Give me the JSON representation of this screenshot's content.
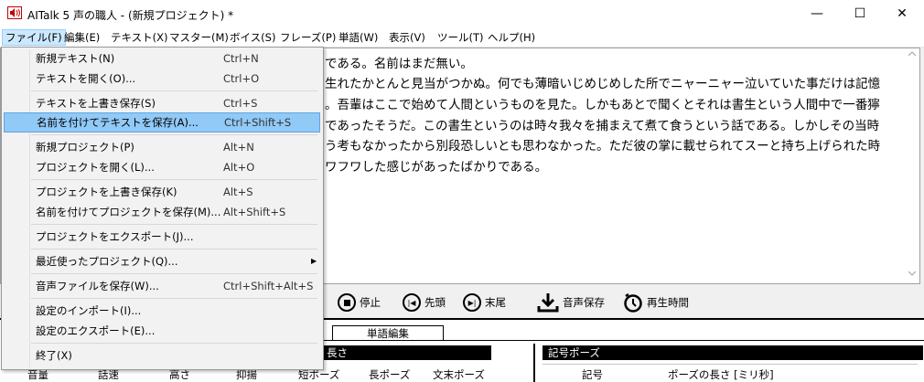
{
  "window": {
    "title": "AITalk 5 声の職人 - (新規プロジェクト) *",
    "controls": {
      "minimize": "—",
      "maximize": "☐",
      "close": "✕"
    }
  },
  "menubar": {
    "items": [
      {
        "label": "ファイル(F)"
      },
      {
        "label": "編集(E)"
      },
      {
        "label": "テキスト(X)"
      },
      {
        "label": "マスター(M)"
      },
      {
        "label": "ボイス(S)"
      },
      {
        "label": "フレーズ(P)"
      },
      {
        "label": "単語(W)"
      },
      {
        "label": "表示(V)"
      },
      {
        "label": "ツール(T)"
      },
      {
        "label": "ヘルプ(H)"
      }
    ]
  },
  "file_menu": {
    "items": [
      {
        "label": "新規テキスト(N)",
        "shortcut": "Ctrl+N"
      },
      {
        "label": "テキストを開く(O)...",
        "shortcut": "Ctrl+O"
      },
      {
        "label": "テキストを上書き保存(S)",
        "shortcut": "Ctrl+S"
      },
      {
        "label": "名前を付けてテキストを保存(A)...",
        "shortcut": "Ctrl+Shift+S"
      },
      {
        "label": "新規プロジェクト(P)",
        "shortcut": "Alt+N"
      },
      {
        "label": "プロジェクトを開く(L)...",
        "shortcut": "Alt+O"
      },
      {
        "label": "プロジェクトを上書き保存(K)",
        "shortcut": "Alt+S"
      },
      {
        "label": "名前を付けてプロジェクトを保存(M)...",
        "shortcut": "Alt+Shift+S"
      },
      {
        "label": "プロジェクトをエクスポート(J)...",
        "shortcut": ""
      },
      {
        "label": "最近使ったプロジェクト(Q)...",
        "shortcut": ""
      },
      {
        "label": "音声ファイルを保存(W)...",
        "shortcut": "Ctrl+Shift+Alt+S"
      },
      {
        "label": "設定のインポート(I)...",
        "shortcut": ""
      },
      {
        "label": "設定のエクスポート(E)...",
        "shortcut": ""
      },
      {
        "label": "終了(X)",
        "shortcut": ""
      }
    ]
  },
  "editor": {
    "lines": [
      "である。名前はまだ無い。",
      "生れたかとんと見当がつかぬ。何でも薄暗いじめじめした所でニャーニャー泣いていた事だけは記憶",
      "。吾輩はここで始めて人間というものを見た。しかもあとで聞くとそれは書生という人間中で一番獰",
      "であったそうだ。この書生というのは時々我々を捕まえて煮て食うという話である。しかしその当時",
      "う考もなかったから別段恐しいとも思わなかった。ただ彼の掌に載せられてスーと持ち上げられた時",
      "ワフワした感じがあったばかりである。"
    ]
  },
  "playback": {
    "stop": "停止",
    "to_start": "先頭",
    "to_end": "末尾",
    "save_audio": "音声保存",
    "play_time": "再生時間"
  },
  "lower": {
    "tab_word_edit": "単語編集",
    "section_length": "長さ",
    "section_symbol_pause": "記号ポーズ",
    "columns": [
      "音量",
      "話速",
      "高さ",
      "抑揚",
      "短ポーズ",
      "長ポーズ",
      "文末ポーズ"
    ],
    "symbol_columns": [
      "記号",
      "ポーズの長さ [ミリ秒]"
    ]
  }
}
